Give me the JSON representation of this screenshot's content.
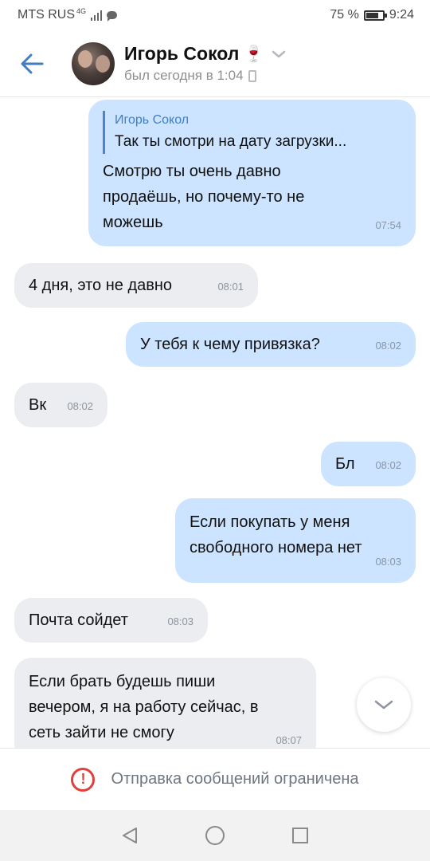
{
  "status_bar": {
    "carrier": "MTS RUS",
    "network": "4G",
    "battery": "75 %",
    "battery_level": 0.75,
    "time": "9:24"
  },
  "header": {
    "contact_name": "Игорь Сокол",
    "emoji": "🍷",
    "last_seen": "был сегодня в 1:04"
  },
  "messages": [
    {
      "direction": "out",
      "quote_author": "Игорь Сокол",
      "quote_text": "Так ты смотри на дату загрузки...",
      "lines": [
        "Смотрю ты очень давно",
        "продаёшь, но почему-то не",
        "можешь"
      ],
      "time": "07:54"
    },
    {
      "direction": "in",
      "lines": [
        "4 дня, это не давно"
      ],
      "time": "08:01"
    },
    {
      "direction": "out",
      "lines": [
        "У тебя к чему привязка?"
      ],
      "time": "08:02"
    },
    {
      "direction": "in",
      "lines": [
        "Вк"
      ],
      "time": "08:02"
    },
    {
      "direction": "out",
      "lines": [
        "Бл"
      ],
      "time": "08:02"
    },
    {
      "direction": "out",
      "lines": [
        "Если покупать у меня",
        "свободного номера нет"
      ],
      "time": "08:03"
    },
    {
      "direction": "in",
      "lines": [
        "Почта сойдет"
      ],
      "time": "08:03"
    },
    {
      "direction": "in",
      "lines": [
        "Если брать будешь пиши",
        "вечером, я на работу сейчас, в",
        "сеть зайти не смогу"
      ],
      "time": "08:07"
    }
  ],
  "notice": {
    "text": "Отправка сообщений ограничена",
    "color": "#e0403d"
  },
  "colors": {
    "accent": "#3f7fc1",
    "outgoing_bubble": "#cce4ff",
    "incoming_bubble": "#ebedf0"
  },
  "icons": {
    "back": "arrow-left-icon",
    "chevron": "chevron-down-icon",
    "scroll_down": "chevron-down-icon",
    "warning": "exclamation-circle-icon"
  }
}
